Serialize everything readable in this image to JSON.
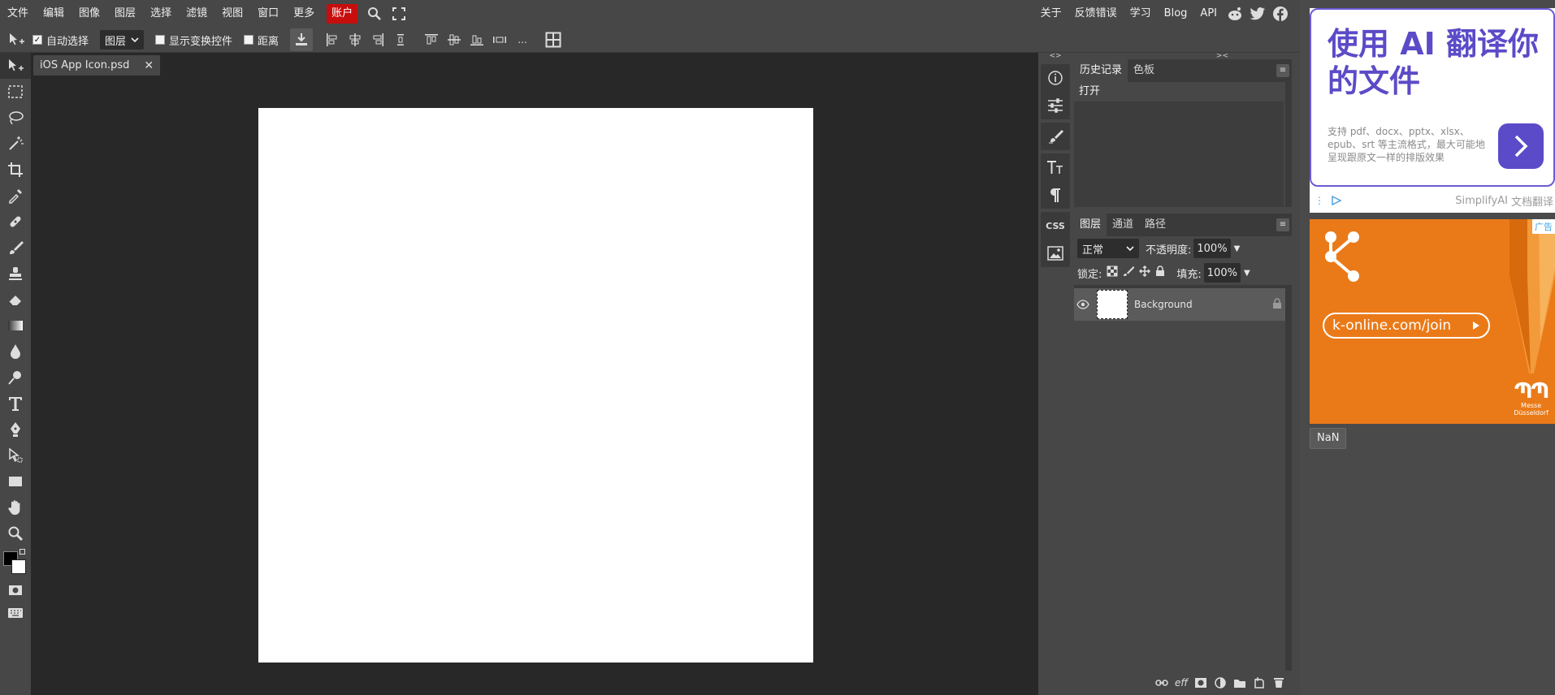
{
  "menubar": {
    "items": [
      "文件",
      "编辑",
      "图像",
      "图层",
      "选择",
      "滤镜",
      "视图",
      "窗口",
      "更多"
    ],
    "account": "账户",
    "right_links": [
      "关于",
      "反馈错误",
      "学习",
      "Blog",
      "API"
    ]
  },
  "options": {
    "auto_select": {
      "label": "自动选择",
      "checked": true
    },
    "select_target": "图层",
    "show_transform": {
      "label": "显示变换控件",
      "checked": false
    },
    "distance": {
      "label": "距离",
      "checked": false
    },
    "more": "..."
  },
  "document": {
    "tab_name": "iOS App Icon.psd",
    "close_glyph": "✕"
  },
  "iconstrip": {
    "css_label": "CSS"
  },
  "history_panel": {
    "tabs": [
      "历史记录",
      "色板"
    ],
    "entries": [
      "打开"
    ]
  },
  "layers_panel": {
    "tabs": [
      "图层",
      "通道",
      "路径"
    ],
    "blend_mode": "正常",
    "opacity_label": "不透明度:",
    "opacity_value": "100%",
    "lock_label": "锁定:",
    "fill_label": "填充:",
    "fill_value": "100%",
    "layers": [
      {
        "name": "Background",
        "visible": true,
        "locked": true
      }
    ],
    "footer_eff": "eff"
  },
  "ads": {
    "ad1": {
      "title": "使用 AI 翻译你的文件",
      "body": "支持 pdf、docx、pptx、xlsx、epub、srt 等主流格式，最大可能地呈现跟原文一样的排版效果",
      "brand": "SimplifyAI",
      "brand_suffix": "文档翻译"
    },
    "ad2": {
      "url": "k-online.com/join",
      "badge": "广告",
      "logo_line1": "Messe",
      "logo_line2": "Düsseldorf"
    },
    "nan_button": "NaN"
  },
  "colors": {
    "bg_panel": "#474747",
    "bg_workspace": "#282828",
    "account_red": "#c80d0d",
    "ad_purple": "#5b4bc8",
    "ad_orange": "#ea7a18"
  }
}
